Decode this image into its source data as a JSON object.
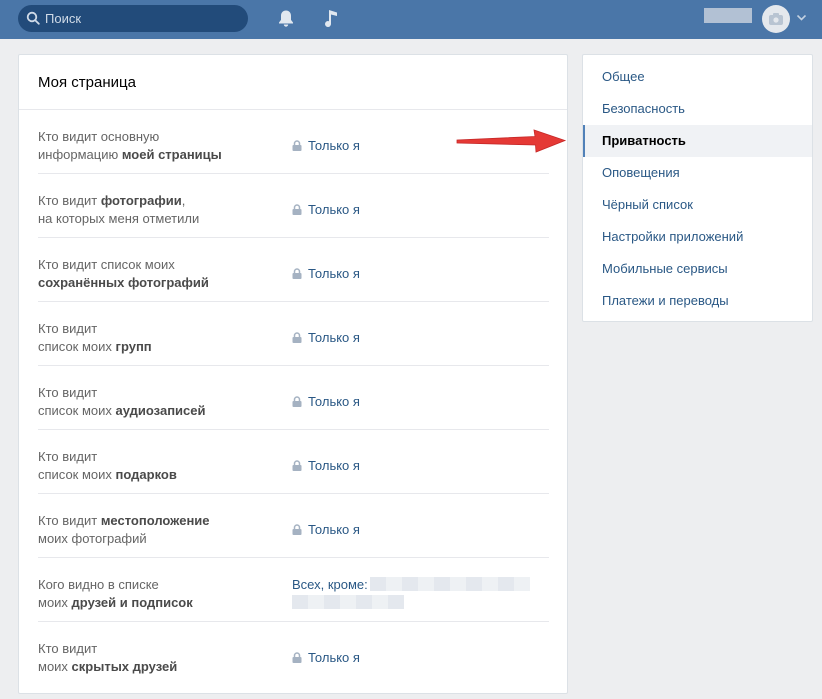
{
  "header": {
    "search_placeholder": "Поиск"
  },
  "main": {
    "title": "Моя страница",
    "rows": [
      {
        "l1": "Кто видит основную",
        "l2a": "информацию ",
        "l2b": "моей страницы",
        "value": "Только я"
      },
      {
        "l1a": "Кто видит ",
        "l1b": "фотографии",
        "l1c": ",",
        "l2": "на которых меня отметили",
        "value": "Только я"
      },
      {
        "l1": "Кто видит список моих",
        "l2b": "сохранённых фотографий",
        "value": "Только я"
      },
      {
        "l1": "Кто видит",
        "l2a": "список моих ",
        "l2b": "групп",
        "value": "Только я"
      },
      {
        "l1": "Кто видит",
        "l2a": "список моих ",
        "l2b": "аудиозаписей",
        "value": "Только я"
      },
      {
        "l1": "Кто видит",
        "l2a": "список моих ",
        "l2b": "подарков",
        "value": "Только я"
      },
      {
        "l1a": "Кто видит ",
        "l1b": "местоположение",
        "l2": "моих фотографий",
        "value": "Только я"
      },
      {
        "l1": "Кого видно в списке",
        "l2a": "моих ",
        "l2b": "друзей и подписок",
        "value": "Всех, кроме:"
      },
      {
        "l1": "Кто видит",
        "l2a": "моих ",
        "l2b": "скрытых друзей",
        "value": "Только я"
      }
    ]
  },
  "side": {
    "items": [
      "Общее",
      "Безопасность",
      "Приватность",
      "Оповещения",
      "Чёрный список",
      "Настройки приложений",
      "Мобильные сервисы",
      "Платежи и переводы"
    ],
    "active_index": 2
  },
  "colors": {
    "header": "#4a76a8",
    "link": "#2a5885",
    "arrow": "#e53935"
  }
}
